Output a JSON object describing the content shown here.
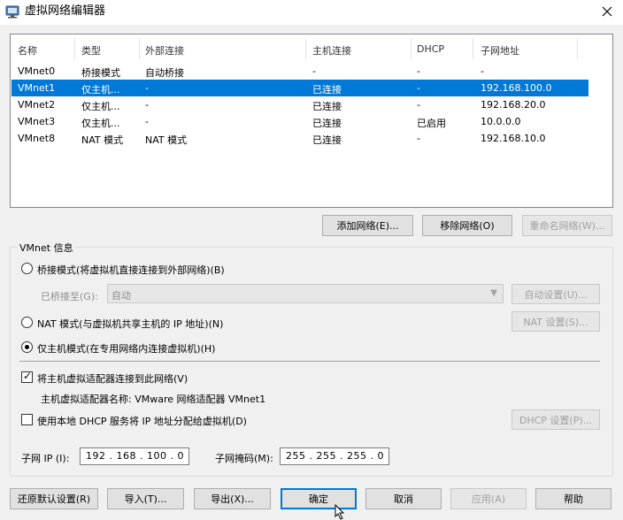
{
  "window": {
    "title": "虚拟网络编辑器",
    "icon": "vmware-network-icon"
  },
  "list": {
    "columns": [
      "名称",
      "类型",
      "外部连接",
      "主机连接",
      "DHCP",
      "子网地址"
    ],
    "rows": [
      {
        "name": "VMnet0",
        "type": "桥接模式",
        "external": "自动桥接",
        "host": "-",
        "dhcp": "-",
        "subnet": "-",
        "selected": false
      },
      {
        "name": "VMnet1",
        "type": "仅主机...",
        "external": "-",
        "host": "已连接",
        "dhcp": "-",
        "subnet": "192.168.100.0",
        "selected": true
      },
      {
        "name": "VMnet2",
        "type": "仅主机...",
        "external": "-",
        "host": "已连接",
        "dhcp": "-",
        "subnet": "192.168.20.0",
        "selected": false
      },
      {
        "name": "VMnet3",
        "type": "仅主机...",
        "external": "-",
        "host": "已连接",
        "dhcp": "已启用",
        "subnet": "10.0.0.0",
        "selected": false
      },
      {
        "name": "VMnet8",
        "type": "NAT 模式",
        "external": "NAT 模式",
        "host": "已连接",
        "dhcp": "-",
        "subnet": "192.168.10.0",
        "selected": false
      }
    ]
  },
  "list_buttons": {
    "add": "添加网络(E)...",
    "remove": "移除网络(O)",
    "rename": "重命名网络(W)..."
  },
  "vmnet_info": {
    "group_label": "VMnet 信息",
    "bridged": {
      "label": "桥接模式(将虚拟机直接连接到外部网络)(B)",
      "checked": false
    },
    "bridged_to": {
      "label": "已桥接至(G):",
      "value": "自动",
      "auto_button": "自动设置(U)..."
    },
    "nat": {
      "label": "NAT 模式(与虚拟机共享主机的 IP 地址)(N)",
      "checked": false,
      "settings_button": "NAT 设置(S)..."
    },
    "host_only": {
      "label": "仅主机模式(在专用网络内连接虚拟机)(H)",
      "checked": true
    },
    "connect_adapter": {
      "label": "将主机虚拟适配器连接到此网络(V)",
      "checked": true
    },
    "adapter_name": "主机虚拟适配器名称: VMware 网络适配器 VMnet1",
    "dhcp": {
      "label": "使用本地 DHCP 服务将 IP 地址分配给虚拟机(D)",
      "checked": false,
      "settings_button": "DHCP 设置(P)..."
    },
    "subnet_ip": {
      "label": "子网 IP (I):",
      "value": "192 . 168 . 100 .  0"
    },
    "subnet_mask": {
      "label": "子网掩码(M):",
      "value": "255 . 255 . 255 .  0"
    }
  },
  "footer_buttons": {
    "restore": "还原默认设置(R)",
    "import": "导入(T)...",
    "export": "导出(X)...",
    "ok": "确定",
    "cancel": "取消",
    "apply": "应用(A)",
    "help": "帮助"
  },
  "colors": {
    "selection": "#0078d7",
    "window_bg": "#f0f0f0",
    "disabled_text": "#a0a0a0"
  }
}
